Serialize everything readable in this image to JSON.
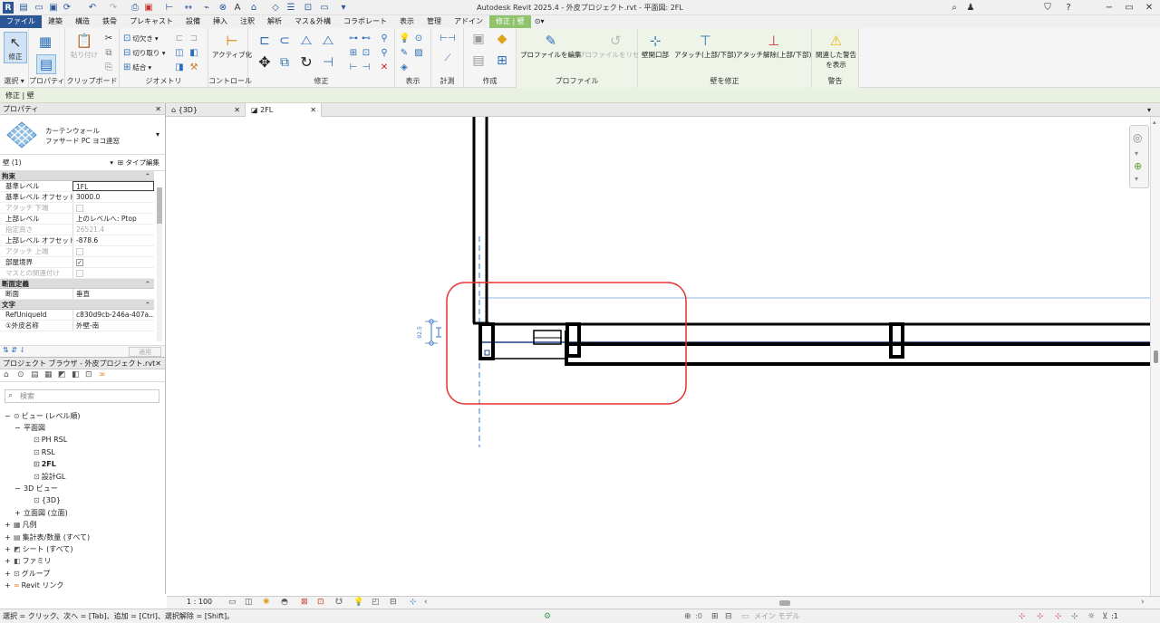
{
  "app_title": "Autodesk Revit 2025.4 - 外皮プロジェクト.rvt - 平面図: 2FL",
  "ribbon_tabs": [
    "ファイル",
    "建築",
    "構造",
    "鉄骨",
    "プレキャスト",
    "設備",
    "挿入",
    "注釈",
    "解析",
    "マス＆外構",
    "コラボレート",
    "表示",
    "管理",
    "アドイン",
    "修正 | 壁"
  ],
  "ribbon": {
    "select": {
      "modify_label": "修正",
      "group_label": "選択 ▾"
    },
    "properties": {
      "group_label": "プロパティ"
    },
    "clipboard": {
      "paste_label": "貼り付け",
      "group_label": "クリップボード"
    },
    "geometry": {
      "cut_label": "切欠き",
      "join_label": "結合",
      "group_label": "ジオメトリ"
    },
    "controls": {
      "activate_label": "アクティブ化",
      "group_label": "コントロール"
    },
    "modify": {
      "group_label": "修正"
    },
    "view": {
      "group_label": "表示"
    },
    "measure": {
      "group_label": "計測"
    },
    "create": {
      "group_label": "作成"
    },
    "profile": {
      "edit_label": "プロファイルを編集",
      "reset_label": "プロファイルをリセット",
      "group_label": "プロファイル"
    },
    "wall_modify": {
      "opening_label": "壁開口部",
      "attach_label": "アタッチ(上部/下部)",
      "detach_label": "アタッチ解除(上部/下部)",
      "group_label": "壁を修正"
    },
    "warnings": {
      "label_line1": "関連した警告",
      "label_line2": "を表示",
      "group_label": "警告"
    }
  },
  "options_bar": "修正 | 壁",
  "properties": {
    "header": "プロパティ",
    "type_line1": "カーテンウォール",
    "type_line2": "ファサード PC ヨコ連窓",
    "instance": "壁 (1)",
    "type_edit": "タイプ編集",
    "categories": [
      {
        "name": "拘束",
        "rows": [
          {
            "name": "基準レベル",
            "value": "1FL",
            "gray": false,
            "type": "input"
          },
          {
            "name": "基準レベル オフセット",
            "value": "3000.0",
            "gray": false,
            "type": "text"
          },
          {
            "name": "アタッチ 下端",
            "value": "",
            "gray": true,
            "type": "check"
          },
          {
            "name": "上部レベル",
            "value": "上のレベルへ: Ptop",
            "gray": false,
            "type": "text"
          },
          {
            "name": "指定高さ",
            "value": "26521.4",
            "gray": true,
            "type": "text"
          },
          {
            "name": "上部レベル オフセット",
            "value": "-878.6",
            "gray": false,
            "type": "text"
          },
          {
            "name": "アタッチ 上端",
            "value": "",
            "gray": true,
            "type": "check"
          },
          {
            "name": "部屋境界",
            "value": "✓",
            "gray": false,
            "type": "check"
          },
          {
            "name": "マスとの関連付け",
            "value": "",
            "gray": true,
            "type": "check"
          }
        ]
      },
      {
        "name": "断面定義",
        "rows": [
          {
            "name": "断面",
            "value": "垂直",
            "gray": false,
            "type": "text"
          }
        ]
      },
      {
        "name": "文字",
        "rows": [
          {
            "name": "RefUniqueId",
            "value": "c830d9cb-246a-407a...",
            "gray": false,
            "type": "text"
          },
          {
            "name": "①外皮名称",
            "value": "外壁-南",
            "gray": false,
            "type": "text"
          }
        ]
      }
    ],
    "apply": "適用"
  },
  "browser": {
    "header": "プロジェクト ブラウザ - 外皮プロジェクト.rvt",
    "search_placeholder": "検索",
    "tree": [
      {
        "label": "ビュー (レベル順)",
        "depth": 0,
        "toggle": "−",
        "icon": "views"
      },
      {
        "label": "平面図",
        "depth": 1,
        "toggle": "−",
        "icon": ""
      },
      {
        "label": "PH RSL",
        "depth": 2,
        "toggle": "",
        "icon": "plan"
      },
      {
        "label": "RSL",
        "depth": 2,
        "toggle": "",
        "icon": "plan"
      },
      {
        "label": "2FL",
        "depth": 2,
        "toggle": "",
        "icon": "plan",
        "bold": true
      },
      {
        "label": "設計GL",
        "depth": 2,
        "toggle": "",
        "icon": "plan"
      },
      {
        "label": "3D ビュー",
        "depth": 1,
        "toggle": "−",
        "icon": ""
      },
      {
        "label": "{3D}",
        "depth": 2,
        "toggle": "",
        "icon": "plan"
      },
      {
        "label": "立面図 (立面)",
        "depth": 1,
        "toggle": "+",
        "icon": ""
      },
      {
        "label": "凡例",
        "depth": 0,
        "toggle": "+",
        "icon": "legend"
      },
      {
        "label": "集計表/数量 (すべて)",
        "depth": 0,
        "toggle": "+",
        "icon": "schedule"
      },
      {
        "label": "シート (すべて)",
        "depth": 0,
        "toggle": "+",
        "icon": "sheet"
      },
      {
        "label": "ファミリ",
        "depth": 0,
        "toggle": "+",
        "icon": "family"
      },
      {
        "label": "グループ",
        "depth": 0,
        "toggle": "+",
        "icon": "group"
      },
      {
        "label": "Revit リンク",
        "depth": 0,
        "toggle": "+",
        "icon": "link"
      }
    ]
  },
  "view_tabs": [
    {
      "label": "{3D}",
      "active": false
    },
    {
      "label": "2FL",
      "active": true
    }
  ],
  "canvas": {
    "dimension_text": "92.5"
  },
  "view_bar": {
    "scale": "1 : 100"
  },
  "status": {
    "text": "選択 = クリック、次へ = [Tab]、追加 = [Ctrl]、選択解除 = [Shift]。",
    "zero": ":0",
    "model": "メイン モデル",
    "filter": ":1"
  },
  "colors": {
    "file_tab": "#2b5797",
    "context_tab": "#8fc36c",
    "highlight_box": "#e53030",
    "ref_plane": "#3a78c9"
  }
}
